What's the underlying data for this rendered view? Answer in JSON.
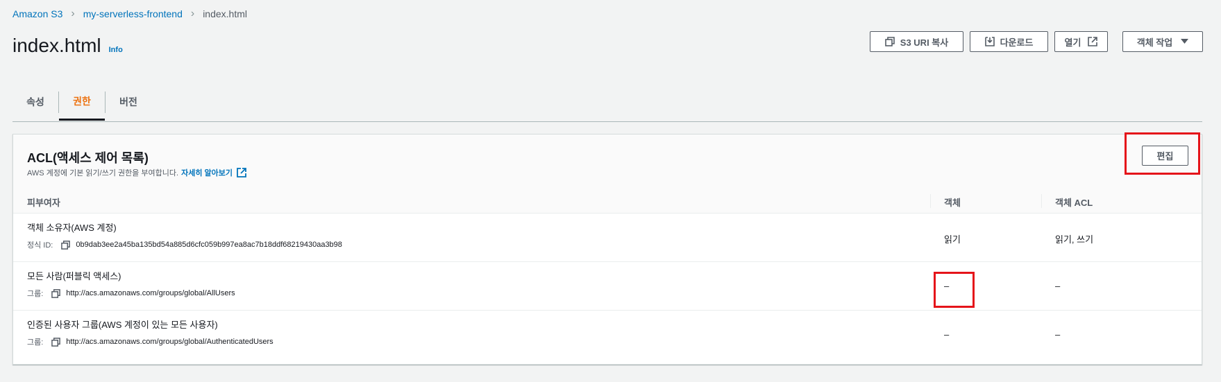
{
  "breadcrumb": {
    "items": [
      "Amazon S3",
      "my-serverless-frontend",
      "index.html"
    ]
  },
  "header": {
    "title": "index.html",
    "info": "Info",
    "buttons": {
      "copy_uri": "S3 URI 복사",
      "download": "다운로드",
      "open": "열기",
      "actions": "객체 작업"
    }
  },
  "tabs": [
    "속성",
    "권한",
    "버전"
  ],
  "active_tab": "권한",
  "acl": {
    "title": "ACL(액세스 제어 목록)",
    "description": "AWS 계정에 기본 읽기/쓰기 권한을 부여합니다.",
    "learn_more": "자세히 알아보기",
    "edit_label": "편집",
    "columns": [
      "피부여자",
      "객체",
      "객체 ACL"
    ],
    "rows": [
      {
        "grantee": "객체 소유자(AWS 계정)",
        "id_label": "정식 ID:",
        "id_value": "0b9dab3ee2a45ba135bd54a885d6cfc059b997ea8ac7b18ddf68219430aa3b98",
        "object": "읽기",
        "object_acl": "읽기, 쓰기"
      },
      {
        "grantee": "모든 사람(퍼블릭 액세스)",
        "id_label": "그룹:",
        "id_value": "http://acs.amazonaws.com/groups/global/AllUsers",
        "object": "–",
        "object_acl": "–"
      },
      {
        "grantee": "인증된 사용자 그룹(AWS 계정이 있는 모든 사용자)",
        "id_label": "그룹:",
        "id_value": "http://acs.amazonaws.com/groups/global/AuthenticatedUsers",
        "object": "–",
        "object_acl": "–"
      }
    ]
  },
  "colors": {
    "link": "#0073bb",
    "active_tab": "#ec7211",
    "highlight": "#e5141a"
  }
}
